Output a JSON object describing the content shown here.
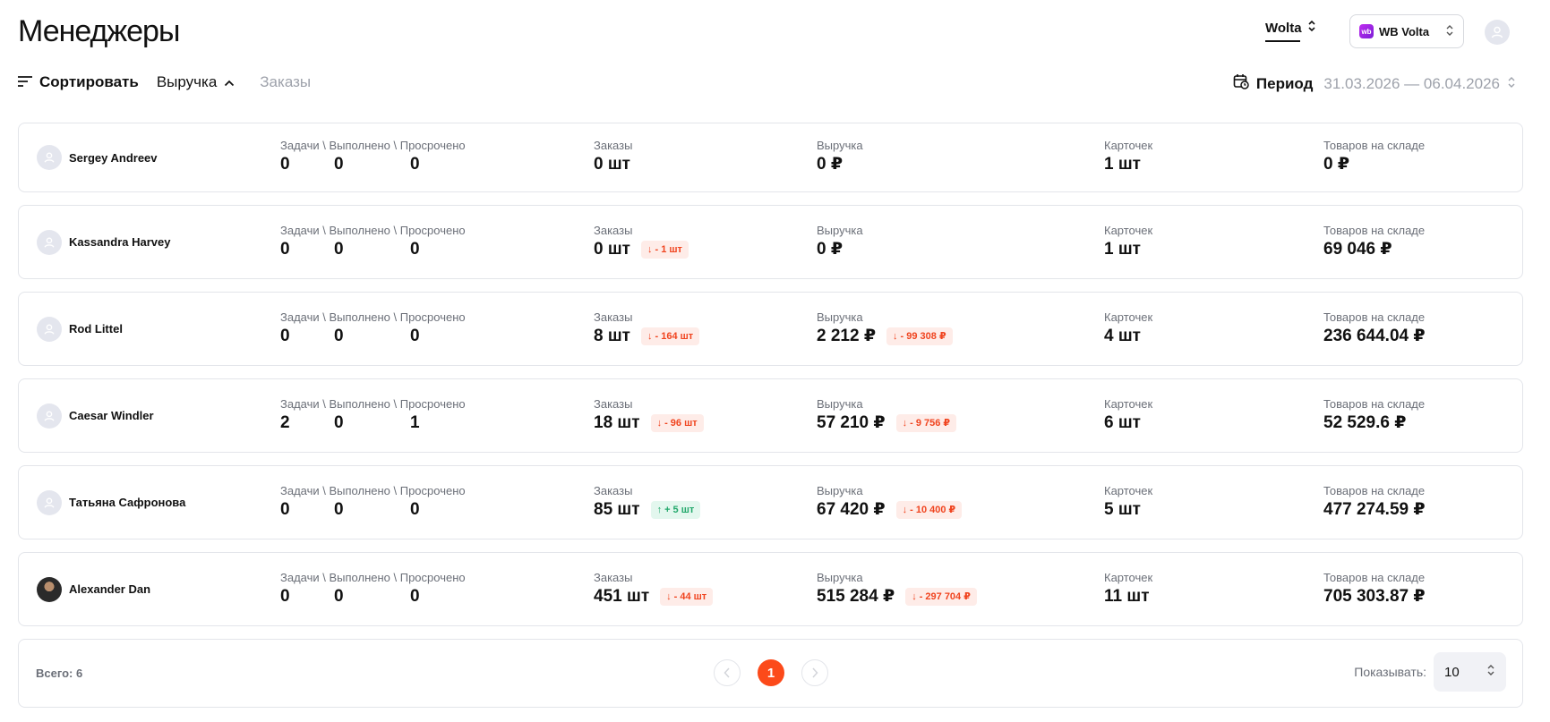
{
  "page": {
    "title": "Менеджеры"
  },
  "header": {
    "org": "Wolta",
    "store": "WB Volta",
    "store_logo": "wb"
  },
  "toolbar": {
    "sort_label": "Сортировать",
    "sort_field": "Выручка",
    "sort_alt": "Заказы",
    "period_label": "Период",
    "period_range": "31.03.2026 — 06.04.2026"
  },
  "labels": {
    "tasks": "Задачи \\ Выполнено \\ Просрочено",
    "orders": "Заказы",
    "revenue": "Выручка",
    "cards": "Карточек",
    "stock": "Товаров на складе"
  },
  "managers": [
    {
      "name": "Sergey Andreev",
      "tasks": "0",
      "done": "0",
      "overdue": "0",
      "orders": "0 шт",
      "orders_delta": "",
      "orders_dir": "",
      "revenue": "0 ₽",
      "revenue_delta": "",
      "cards": "1 шт",
      "stock": "0 ₽"
    },
    {
      "name": "Kassandra Harvey",
      "tasks": "0",
      "done": "0",
      "overdue": "0",
      "orders": "0 шт",
      "orders_delta": "- 1 шт",
      "orders_dir": "down",
      "revenue": "0 ₽",
      "revenue_delta": "",
      "cards": "1 шт",
      "stock": "69 046 ₽"
    },
    {
      "name": "Rod Littel",
      "tasks": "0",
      "done": "0",
      "overdue": "0",
      "orders": "8 шт",
      "orders_delta": "- 164 шт",
      "orders_dir": "down",
      "revenue": "2 212 ₽",
      "revenue_delta": "- 99 308 ₽",
      "cards": "4 шт",
      "stock": "236 644.04 ₽"
    },
    {
      "name": "Caesar Windler",
      "tasks": "2",
      "done": "0",
      "overdue": "1",
      "orders": "18 шт",
      "orders_delta": "- 96 шт",
      "orders_dir": "down",
      "revenue": "57 210 ₽",
      "revenue_delta": "- 9 756 ₽",
      "cards": "6 шт",
      "stock": "52 529.6 ₽"
    },
    {
      "name": "Татьяна Сафронова",
      "tasks": "0",
      "done": "0",
      "overdue": "0",
      "orders": "85 шт",
      "orders_delta": "+ 5 шт",
      "orders_dir": "up",
      "revenue": "67 420 ₽",
      "revenue_delta": "- 10 400 ₽",
      "cards": "5 шт",
      "stock": "477 274.59 ₽"
    },
    {
      "name": "Alexander Dan",
      "tasks": "0",
      "done": "0",
      "overdue": "0",
      "orders": "451 шт",
      "orders_delta": "- 44 шт",
      "orders_dir": "down",
      "revenue": "515 284 ₽",
      "revenue_delta": "- 297 704 ₽",
      "cards": "11 шт",
      "stock": "705 303.87 ₽"
    }
  ],
  "footer": {
    "total": "Всего: 6",
    "page": "1",
    "per_page_label": "Показывать:",
    "per_page": "10"
  },
  "colors": {
    "accent": "#fc4a1a",
    "down": "#f0441f",
    "up": "#22a86b"
  }
}
